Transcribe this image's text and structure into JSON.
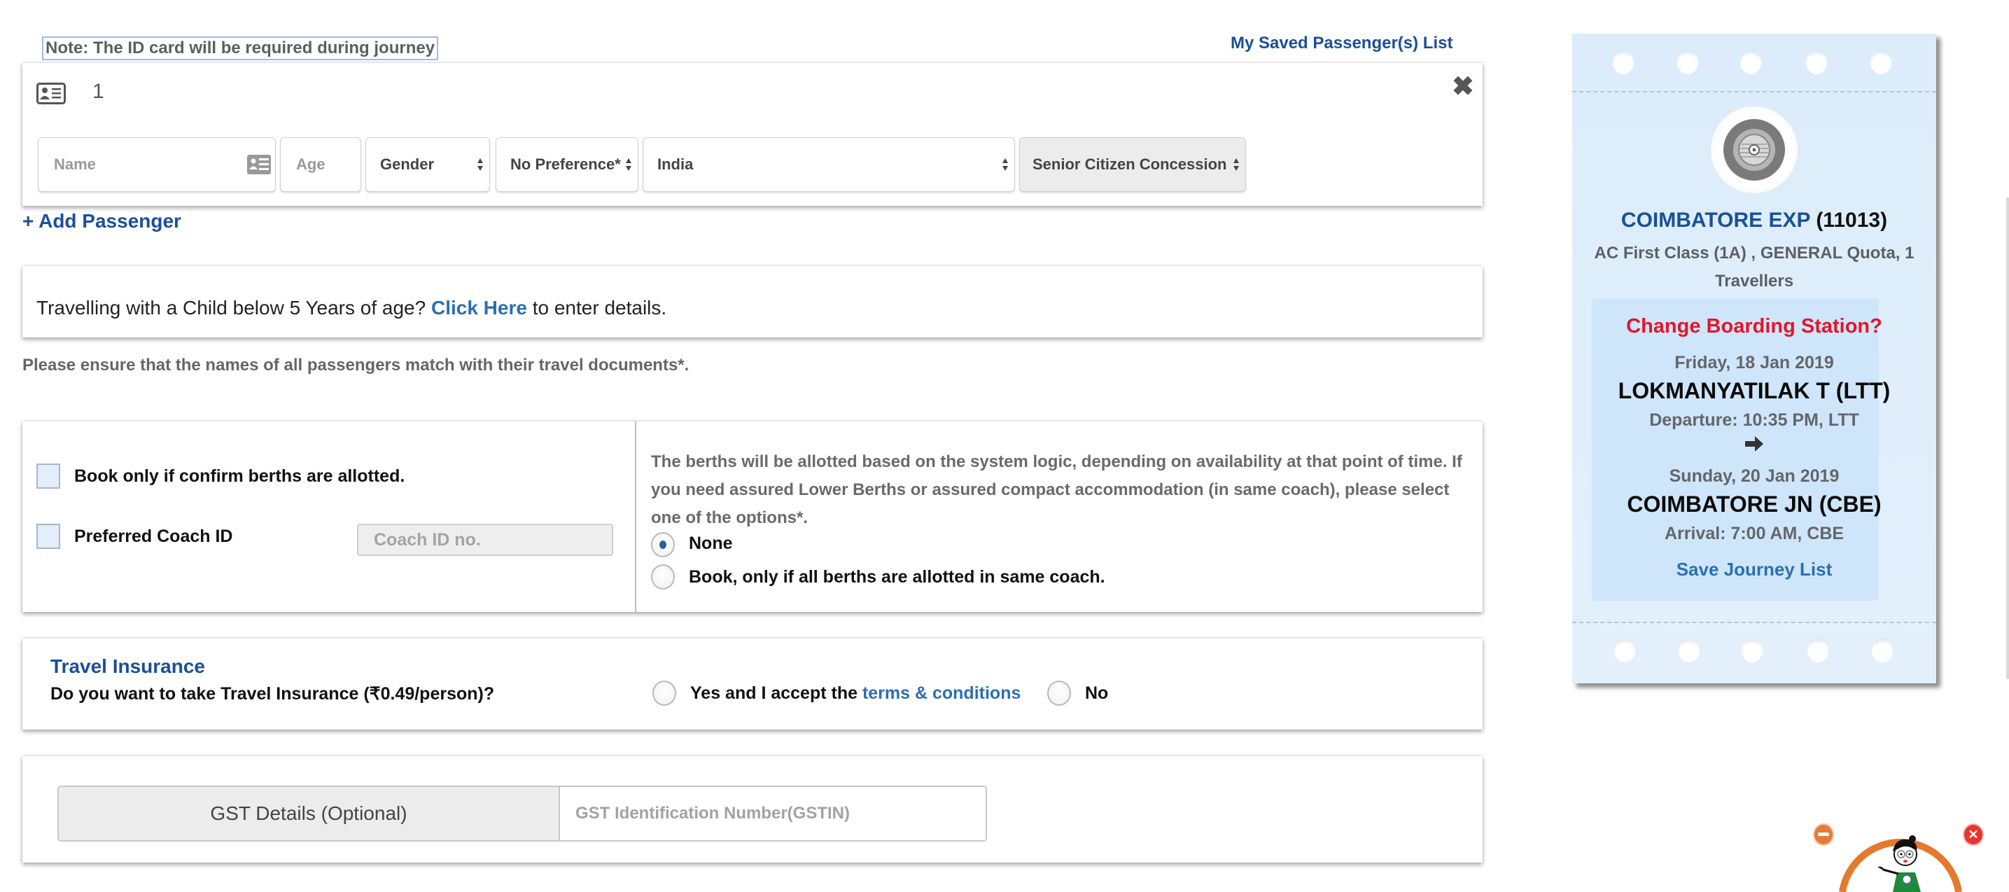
{
  "top": {
    "note": "Note: The ID card will be required during journey",
    "saved_passengers_link": "My Saved Passenger(s) List"
  },
  "passenger": {
    "number": "1",
    "close_icon": "✖",
    "name_placeholder": "Name",
    "age_placeholder": "Age",
    "gender": "Gender",
    "berth_preference": "No Preference*",
    "nationality": "India",
    "concession": "Senior Citizen Concession"
  },
  "add_passenger": "+ Add Passenger",
  "child": {
    "prefix": "Travelling with a Child below 5 Years of age?",
    "link": "Click Here",
    "suffix": "to enter details."
  },
  "ensure_note": "Please ensure that the names of all passengers match with their travel documents*.",
  "berth_options": {
    "confirm_only_label": "Book only if confirm berths are allotted.",
    "confirm_only_checked": false,
    "preferred_coach_label": "Preferred Coach ID",
    "preferred_coach_checked": false,
    "coach_placeholder": "Coach ID no.",
    "info": "The berths will be allotted based on the system logic, depending on availability at that point of time. If you need assured Lower Berths or assured compact accommodation (in same coach), please select one of the options*.",
    "radio_none": "None",
    "radio_same_coach": "Book, only if all berths are allotted in same coach.",
    "selected": "none"
  },
  "insurance": {
    "title": "Travel Insurance",
    "question": "Do you want to take Travel Insurance (₹0.49/person)?",
    "yes_prefix": "Yes and I accept the",
    "yes_link": "terms & conditions",
    "no": "No"
  },
  "gst": {
    "label": "GST Details (Optional)",
    "placeholder": "GST Identification Number(GSTIN)"
  },
  "ticket": {
    "train_name": "COIMBATORE EXP",
    "train_number": "(11013)",
    "class_quota": "AC First Class (1A) , GENERAL Quota, 1 Travellers",
    "change_boarding": "Change Boarding Station?",
    "departure_date": "Friday, 18 Jan 2019",
    "departure_station": "LOKMANYATILAK T (LTT)",
    "departure_time": "Departure: 10:35 PM, LTT",
    "arrival_date": "Sunday, 20 Jan 2019",
    "arrival_station": "COIMBATORE JN (CBE)",
    "arrival_time": "Arrival: 7:00 AM, CBE",
    "save_journey": "Save Journey List"
  },
  "mascot": {
    "close_icon": "✕"
  },
  "colors": {
    "link_blue": "#1a4f9a",
    "accent_blue": "#2b6fb0",
    "alert_red": "#e3152b",
    "ticket_bg": "#dcecfa"
  }
}
